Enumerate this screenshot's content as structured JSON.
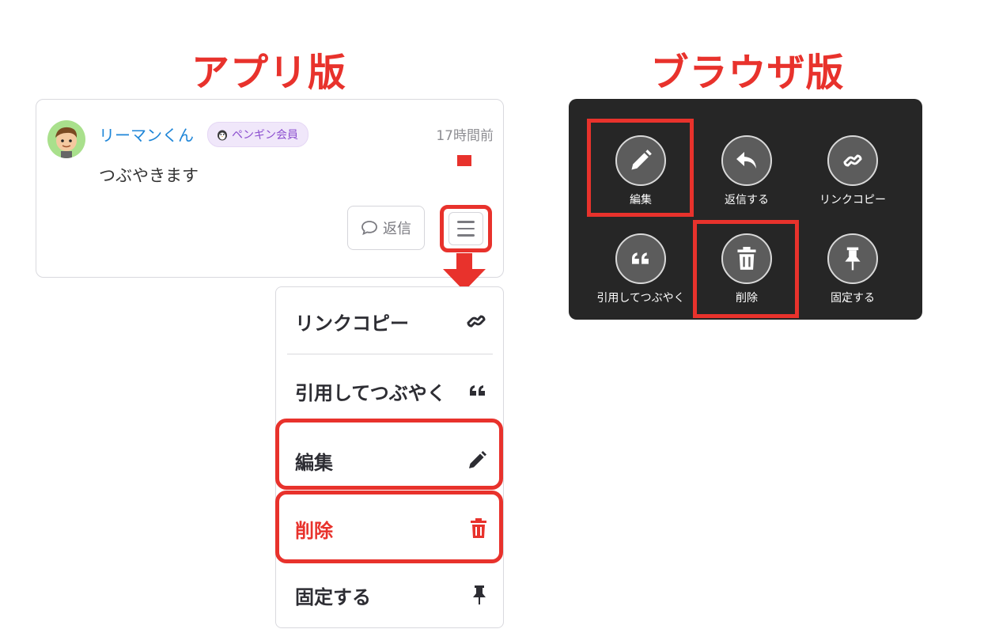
{
  "titles": {
    "app": "アプリ版",
    "browser": "ブラウザ版"
  },
  "post": {
    "username": "リーマンくん",
    "badge": "ペンギン会員",
    "timestamp": "17時間前",
    "text": "つぶやきます",
    "reply_label": "返信"
  },
  "app_menu": {
    "link_copy": "リンクコピー",
    "quote": "引用してつぶやく",
    "edit": "編集",
    "delete": "削除",
    "pin": "固定する"
  },
  "browser_menu": {
    "edit": "編集",
    "reply": "返信する",
    "link_copy": "リンクコピー",
    "quote": "引用してつぶやく",
    "delete": "削除",
    "pin": "固定する"
  },
  "icons": {
    "menu": "hamburger-icon",
    "reply": "speech-bubble-icon",
    "link": "link-icon",
    "quote": "quote-icon",
    "edit": "pencil-icon",
    "delete": "trash-icon",
    "pin": "pin-icon",
    "reply_arrow": "reply-arrow-icon"
  },
  "colors": {
    "accent": "#e8322c",
    "username": "#1f86d8",
    "badge": "#8c4fcf",
    "panel": "#262626"
  }
}
